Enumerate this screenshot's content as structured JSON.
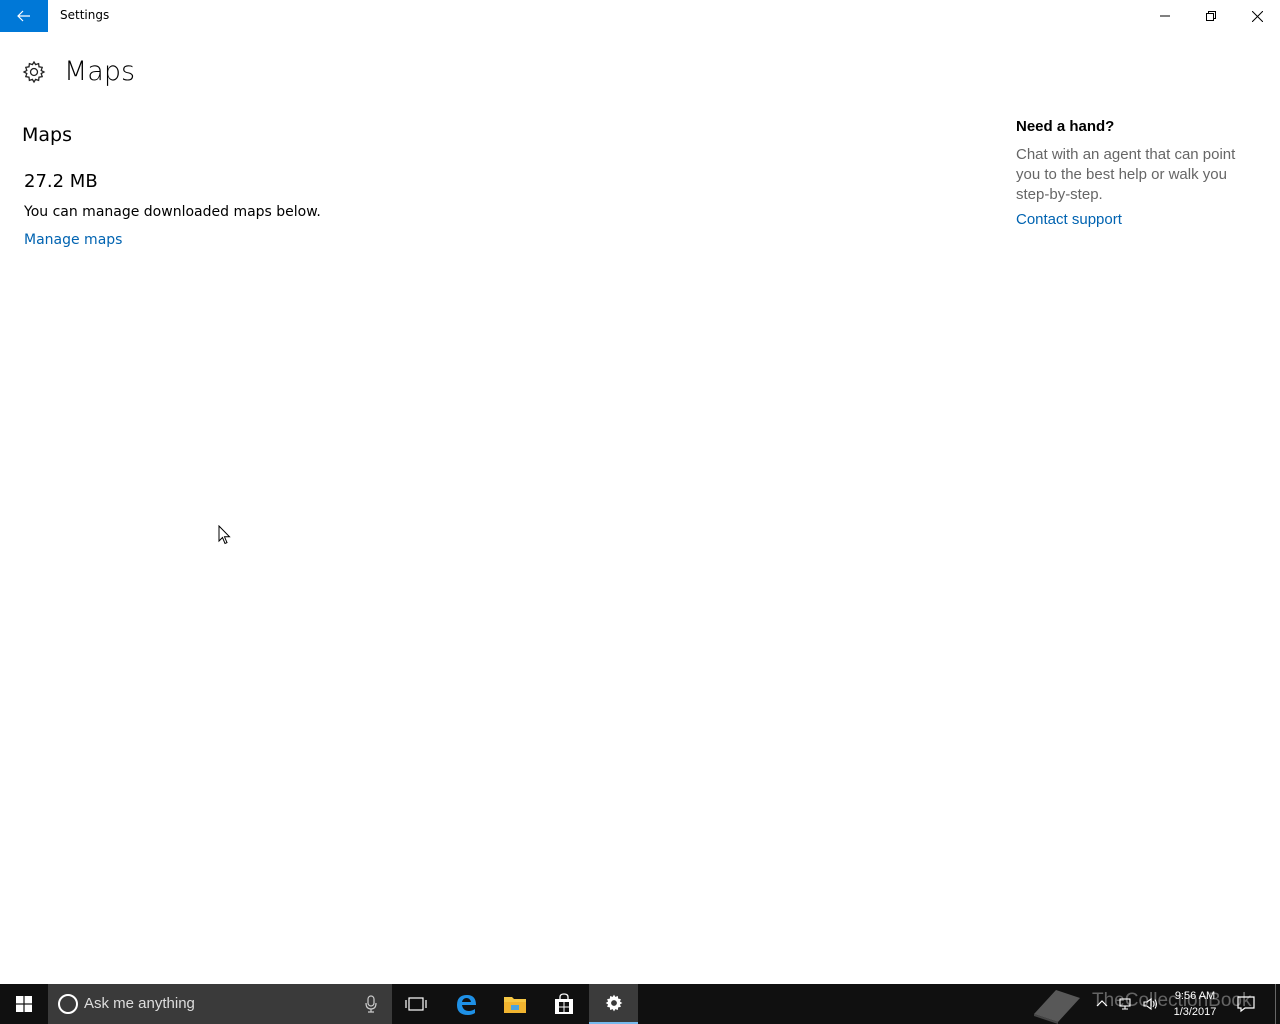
{
  "window": {
    "title": "Settings",
    "accent": "#0078d7"
  },
  "page": {
    "title": "Maps"
  },
  "maps": {
    "section_title": "Maps",
    "storage_size": "27.2 MB",
    "description": "You can manage downloaded maps below.",
    "manage_link": "Manage maps"
  },
  "help": {
    "title": "Need a hand?",
    "text": "Chat with an agent that can point you to the best help or walk you step-by-step.",
    "link": "Contact support"
  },
  "taskbar": {
    "search_placeholder": "Ask me anything",
    "time": "9:56 AM",
    "date": "1/3/2017",
    "watermark": "TheCollectionBook",
    "icons": [
      "windows-start-icon",
      "cortana-icon",
      "microphone-icon",
      "task-view-icon",
      "edge-icon",
      "file-explorer-icon",
      "store-icon",
      "settings-gear-icon",
      "chevron-up-icon",
      "network-icon",
      "volume-icon",
      "action-center-icon"
    ]
  }
}
